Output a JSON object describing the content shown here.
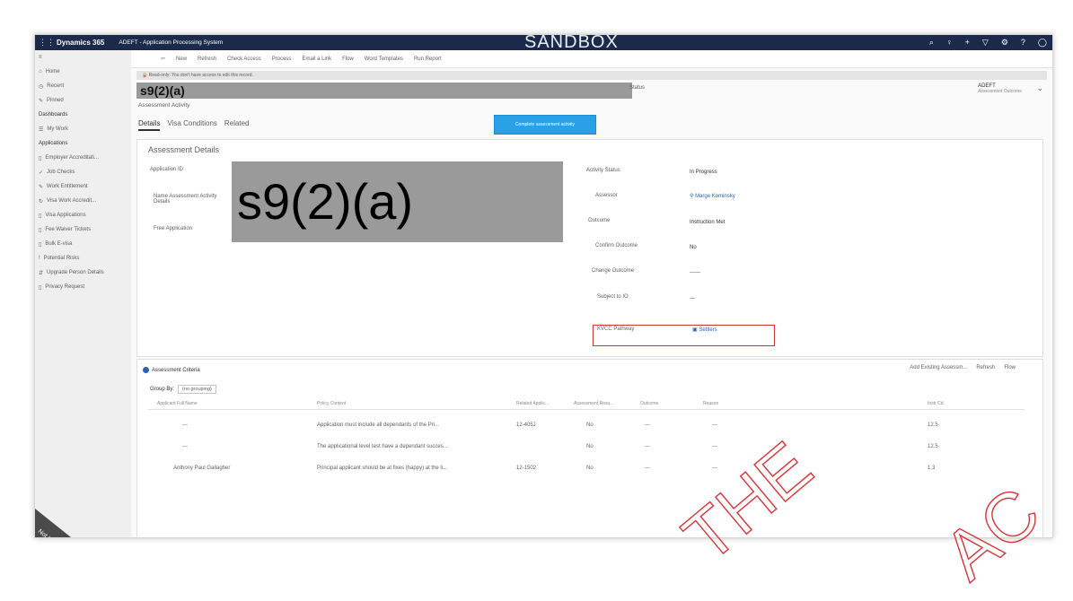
{
  "topbar": {
    "grid_icon": "⋮⋮",
    "brand": "Dynamics 365",
    "app_name": "ADEFT - Application Processing System",
    "environment_banner": "SANDBOX"
  },
  "command_bar": [
    "New",
    "Refresh",
    "Check Access",
    "Process",
    "Email a Link",
    "Flow",
    "Word Templates",
    "Run Report"
  ],
  "sidebar": {
    "items": [
      {
        "label": "Home",
        "icon": "⌂"
      },
      {
        "label": "Recent",
        "icon": "◷"
      },
      {
        "label": "Pinned",
        "icon": "✎"
      }
    ],
    "dashboards_heading": "Dashboards",
    "dashboards": [
      {
        "label": "My Work",
        "icon": "☰"
      }
    ],
    "applications_heading": "Applications",
    "applications": [
      {
        "label": "Employer Accreditati...",
        "icon": "▯"
      },
      {
        "label": "Job Checks",
        "icon": "✓"
      },
      {
        "label": "Work Entitlement",
        "icon": "✎"
      },
      {
        "label": "Visa Work Accredit...",
        "icon": "↻"
      },
      {
        "label": "Visa Applications",
        "icon": "▯"
      },
      {
        "label": "Fee Waiver Tickets",
        "icon": "▯"
      },
      {
        "label": "Bulk E-visa",
        "icon": "▯"
      },
      {
        "label": "Potential Risks",
        "icon": "!"
      },
      {
        "label": "Upgrade Person Details",
        "icon": "⇵"
      },
      {
        "label": "Privacy Request",
        "icon": "▯"
      }
    ]
  },
  "notice": "Read-only: You don't have access to edit this record.",
  "record": {
    "title": "s9(2)(a)",
    "subtitle": "Assessment Activity",
    "header_field": "Status",
    "owner_name": "ADEFT",
    "owner_role": "Assessment Outcome",
    "complete_button": "Complete assessment activity"
  },
  "tabs": [
    "Details",
    "Visa Conditions",
    "Related"
  ],
  "details": {
    "section_title": "Assessment Details",
    "left_labels": [
      "Application ID",
      "Name Assessment Activity Details",
      "Free Application"
    ],
    "redaction": "s9(2)(a)",
    "fields": [
      {
        "label": "Activity Status",
        "value": "In Progress"
      },
      {
        "label": "Assessor",
        "value": "Marge Kominsky"
      },
      {
        "label": "Outcome",
        "value": "Instruction Met"
      },
      {
        "label": "Confirm Outcome",
        "value": "No"
      },
      {
        "label": "Change Outcome",
        "value": "------"
      },
      {
        "label": "Subject to IO",
        "value": "---"
      },
      {
        "label": "KVCC Pathway",
        "value": "Settlers"
      }
    ]
  },
  "criteria": {
    "title": "Assessment Criteria",
    "tools": [
      "Add Existing Assessm...",
      "Refresh",
      "Flow"
    ],
    "group_by_label": "Group By:",
    "group_by_value": "(no grouping)",
    "columns": [
      "Applicant Full Name",
      "Policy Content",
      "Related Applic...",
      "Assessment Resu...",
      "Outcome",
      "Reason",
      "Instr Cd"
    ],
    "rows": [
      {
        "applicant": "---",
        "policy": "Application must include all dependants of the Pri...",
        "related": "12-405J",
        "result": "No",
        "outcome": "---",
        "reason": "---",
        "code": "12.5"
      },
      {
        "applicant": "---",
        "policy": "The applicational level test have a dependant succes...",
        "related": "",
        "result": "No",
        "outcome": "---",
        "reason": "---",
        "code": "12.5"
      },
      {
        "applicant": "Anthony Paul Gallagher",
        "policy": "Principal applicant should be at fixes (happy) at the li...",
        "related": "12-1502",
        "result": "No",
        "outcome": "---",
        "reason": "---",
        "code": "1.3"
      }
    ]
  },
  "watermark": [
    "THE",
    "AC"
  ],
  "corner_label": "Not Hi"
}
